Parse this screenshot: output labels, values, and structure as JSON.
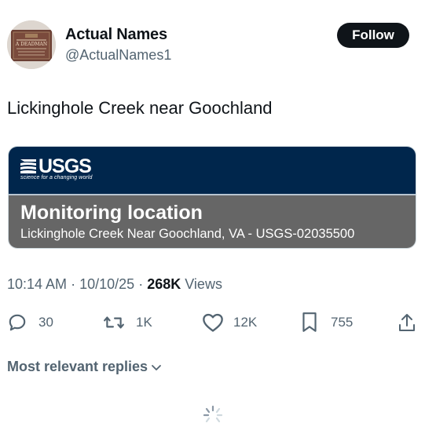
{
  "profile": {
    "display_name": "Actual Names",
    "handle": "@ActualNames1",
    "avatar_text": [
      "A DEADMAN"
    ]
  },
  "follow_label": "Follow",
  "tweet": {
    "text": "Lickinghole Creek near Goochland"
  },
  "card": {
    "logo_text": "USGS",
    "logo_tagline": "science for a changing world",
    "title": "Monitoring location",
    "subtitle": "Lickinghole Creek Near Goochland, VA - USGS-02035500",
    "colors": {
      "header": "#00264c",
      "body": "#666666"
    }
  },
  "meta": {
    "time": "10:14 AM",
    "separator": "·",
    "date": "10/10/25",
    "views_count": "268K",
    "views_label": "Views"
  },
  "actions": {
    "replies": "30",
    "reposts": "1K",
    "likes": "12K",
    "bookmarks": "755",
    "icons": [
      "reply-icon",
      "repost-icon",
      "like-icon",
      "bookmark-icon",
      "share-icon"
    ]
  },
  "replies_sort": {
    "label": "Most relevant replies"
  }
}
